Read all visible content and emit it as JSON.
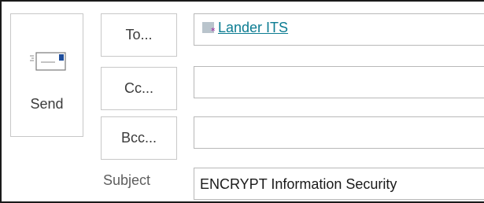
{
  "send": {
    "label": "Send",
    "icon": "send-mail-icon"
  },
  "addressing": {
    "to_label": "To...",
    "cc_label": "Cc...",
    "bcc_label": "Bcc...",
    "to_recipients": [
      {
        "name": "Lander ITS",
        "icon": "distribution-list-icon"
      }
    ],
    "cc_value": "",
    "bcc_value": ""
  },
  "subject": {
    "label": "Subject",
    "value": "ENCRYPT Information Security"
  },
  "colors": {
    "recipient_link": "#0c7c92",
    "send_icon_accent": "#1f4e9c"
  }
}
